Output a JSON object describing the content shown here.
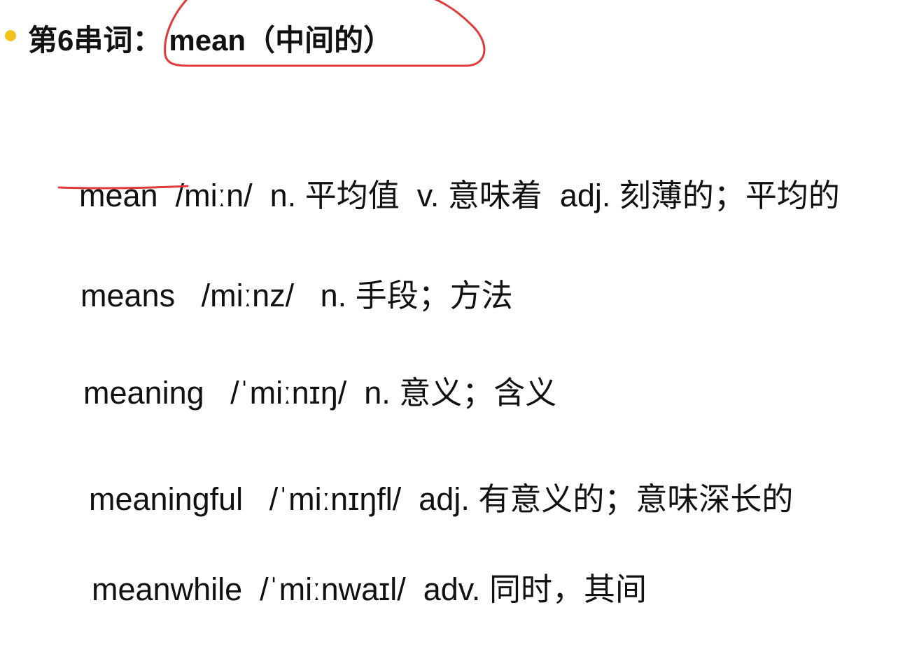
{
  "header": {
    "label": "第6串词：",
    "headword": "mean",
    "gloss": "（中间的）"
  },
  "annotation_color": "#e03a3a",
  "bullet_color": "#f2c31a",
  "entries": [
    {
      "word": "mean",
      "phonetic": "/miːn/",
      "definition": "n. 平均值  v. 意味着  adj. 刻薄的；平均的"
    },
    {
      "word": "means",
      "phonetic": "/miːnz/",
      "definition": "n. 手段；方法"
    },
    {
      "word": "meaning",
      "phonetic": "/ˈmiːnɪŋ/",
      "definition": "n. 意义；含义"
    },
    {
      "word": "meaningful",
      "phonetic": "/ˈmiːnɪŋfl/",
      "definition": "adj. 有意义的；意味深长的"
    },
    {
      "word": "meanwhile",
      "phonetic": "/ˈmiːnwaɪl/",
      "definition": "adv. 同时，其间"
    }
  ]
}
